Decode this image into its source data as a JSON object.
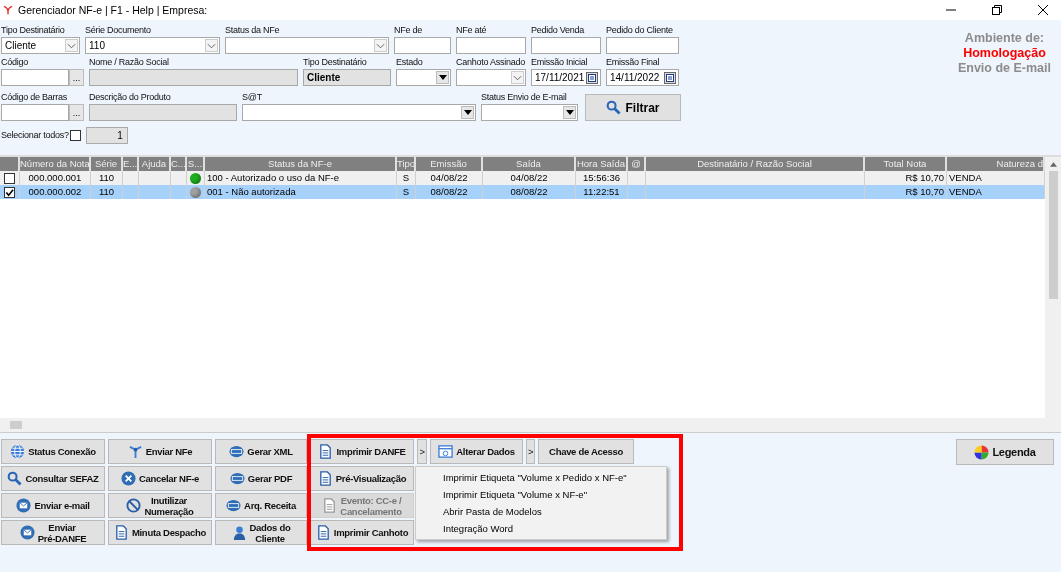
{
  "window": {
    "title": "Gerenciador NF-e | F1 - Help | Empresa:"
  },
  "filters": [
    [
      {
        "label": "Tipo Destinatário",
        "kind": "combo",
        "value": "Cliente"
      },
      {
        "label": "Série Documento",
        "kind": "combo",
        "value": "110"
      },
      {
        "label": "Status da NFe",
        "kind": "combo"
      },
      {
        "label": "NFe de",
        "kind": "text"
      },
      {
        "label": "NFe até",
        "kind": "text"
      },
      {
        "label": "Pedido Venda",
        "kind": "text"
      },
      {
        "label": "Pedido do Cliente",
        "kind": "text"
      }
    ],
    [
      {
        "label": "Código",
        "kind": "lookup",
        "button": "..."
      },
      {
        "label": "Nome / Razão Social",
        "kind": "readonly"
      },
      {
        "label": "Tipo Destinatário",
        "kind": "readonly",
        "value": "Cliente"
      },
      {
        "label": "Estado",
        "kind": "dropdown"
      },
      {
        "label": "Canhoto Assinado",
        "kind": "combo"
      },
      {
        "label": "Emissão Inicial",
        "kind": "date",
        "value": "17/11/2021"
      },
      {
        "label": "Emissão Final",
        "kind": "date",
        "value": "14/11/2022"
      }
    ],
    [
      {
        "label": "Código de Barras",
        "kind": "lookup",
        "button": "..."
      },
      {
        "label": "Descrição do Produto",
        "kind": "readonly"
      },
      {
        "label": "S@T",
        "kind": "dropdown"
      },
      {
        "label": "Status Envio de E-mail",
        "kind": "dropdown"
      }
    ]
  ],
  "filter_button": "Filtrar",
  "environment": {
    "label": "Ambiente de:",
    "value": "Homologação",
    "mode": "Envio de E-mail"
  },
  "select_all": {
    "label": "Selecionar todos?",
    "checked": false,
    "count": "1"
  },
  "table": {
    "columns": [
      "Número da Nota",
      "Série",
      "E...",
      "Ajuda",
      "C...",
      "S...",
      "Status da NF-e",
      "Tipo",
      "Emissão",
      "Saída",
      "Hora Saída",
      "@",
      "Destinatário / Razão Social",
      "Total Nota",
      "Natureza d"
    ],
    "rows": [
      {
        "checked": false,
        "selected": false,
        "number": "000.000.001",
        "series": "110",
        "color": "#1fae1f",
        "status": "100 - Autorizado o uso da NF-e",
        "type": "S",
        "issue_date": "04/08/22",
        "exit_date": "04/08/22",
        "exit_time": "15:56:36",
        "total": "R$ 10,70",
        "nature": "VENDA"
      },
      {
        "checked": true,
        "selected": true,
        "number": "000.000.002",
        "series": "110",
        "color": "#a0a0a0",
        "status": "001 - Não autorizada",
        "type": "S",
        "issue_date": "08/08/22",
        "exit_date": "08/08/22",
        "exit_time": "11:22:51",
        "total": "R$ 10,70",
        "nature": "VENDA"
      }
    ]
  },
  "actions": [
    [
      {
        "kind": "button",
        "label": "Status Conexão",
        "disabled": false
      },
      {
        "kind": "button",
        "label": "Enviar NFe",
        "disabled": false
      },
      {
        "kind": "button",
        "label": "Gerar XML",
        "disabled": false
      },
      {
        "kind": "button",
        "label": "Imprimir DANFE",
        "disabled": false
      },
      {
        "kind": "arrow",
        "label": ">"
      },
      {
        "kind": "button",
        "label": "Alterar Dados",
        "disabled": false
      },
      {
        "kind": "arrow",
        "label": ">"
      },
      {
        "kind": "button",
        "label": "Chave de Acesso",
        "disabled": false
      }
    ],
    [
      {
        "kind": "button",
        "label": "Consultar SEFAZ",
        "disabled": false
      },
      {
        "kind": "button",
        "label": "Cancelar NF-e",
        "disabled": false
      },
      {
        "kind": "button",
        "label": "Gerar PDF",
        "disabled": false
      },
      {
        "kind": "button",
        "label": "Pré-Visualização",
        "disabled": false
      }
    ],
    [
      {
        "kind": "button",
        "label": "Enviar e-mail",
        "disabled": false
      },
      {
        "kind": "button",
        "label": "Inutilizar\nNumeração",
        "disabled": false
      },
      {
        "kind": "button",
        "label": "Arq. Receita",
        "disabled": false
      },
      {
        "kind": "button",
        "label": "Evento: CC-e /\nCancelamento",
        "disabled": true
      }
    ],
    [
      {
        "kind": "button",
        "label": "Enviar\nPré-DANFE",
        "disabled": false
      },
      {
        "kind": "button",
        "label": "Minuta Despacho",
        "disabled": false
      },
      {
        "kind": "button",
        "label": "Dados do\nCliente",
        "disabled": false
      },
      {
        "kind": "button",
        "label": "Imprimir Canhoto",
        "disabled": false
      }
    ]
  ],
  "menu": {
    "items": [
      "Imprimir Etiqueta \"Volume x Pedido x NF-e\"",
      "Imprimir Etiqueta \"Volume x NF-e\"",
      "Abrir Pasta de Modelos",
      "Integração Word"
    ]
  },
  "legend_button": "Legenda"
}
